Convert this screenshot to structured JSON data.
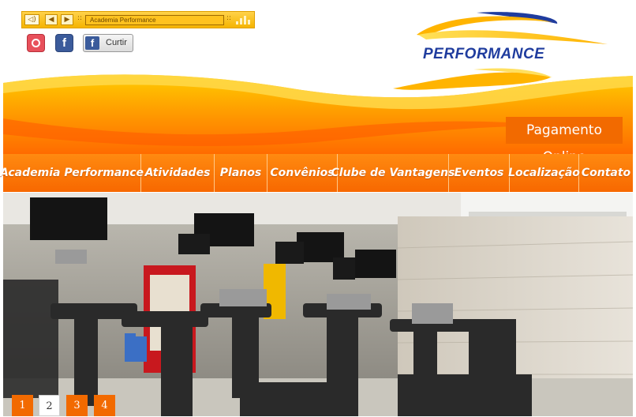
{
  "player": {
    "track_title": "Academia Performance",
    "separator": "::"
  },
  "social": {
    "instagram_icon": "instagram-icon",
    "facebook_icon": "facebook-icon",
    "like_label": "Curtir"
  },
  "logo": {
    "text": "PERFORMANCE"
  },
  "header": {
    "payment_label": "Pagamento Online"
  },
  "nav": {
    "items": [
      {
        "label": "Academia Performance"
      },
      {
        "label": "Atividades"
      },
      {
        "label": "Planos"
      },
      {
        "label": "Convênios"
      },
      {
        "label": "Clube de Vantagens"
      },
      {
        "label": "Eventos"
      },
      {
        "label": "Localização"
      },
      {
        "label": "Contato"
      }
    ]
  },
  "slider": {
    "pages": [
      "1",
      "2",
      "3",
      "4"
    ],
    "active_page": "2"
  },
  "colors": {
    "brand_orange": "#f76800",
    "logo_blue": "#1f3c9e",
    "player_yellow": "#f5b400"
  }
}
